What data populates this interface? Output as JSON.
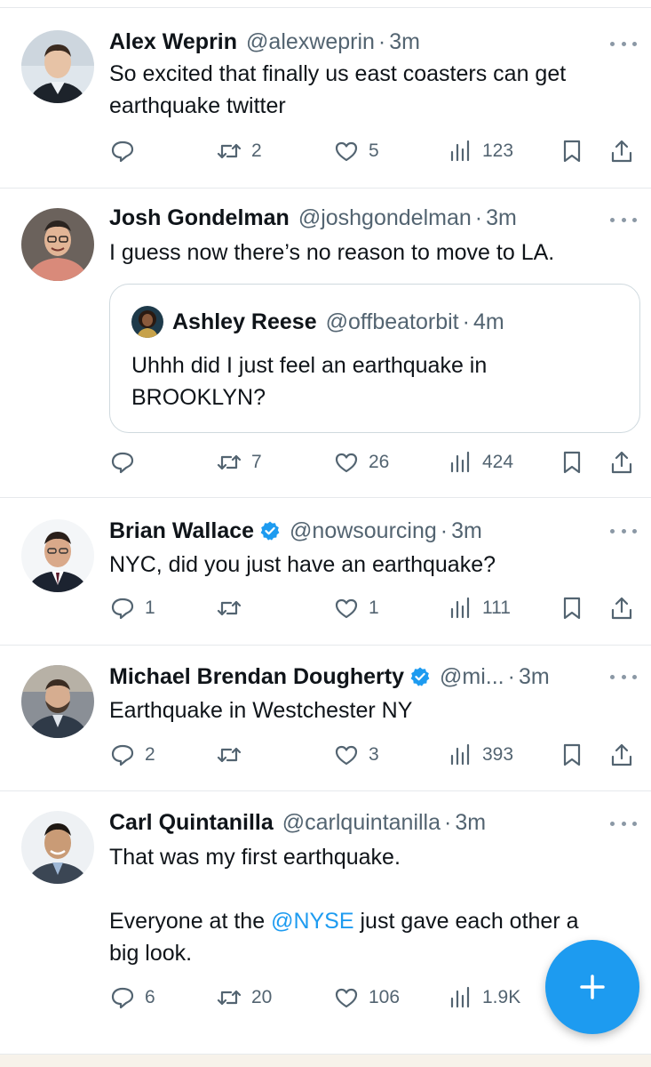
{
  "tweets": [
    {
      "name": "Alex Weprin",
      "handle": "@alexweprin",
      "time": "3m",
      "verified": false,
      "text_lines": [
        "So excited that finally us east coasters can get",
        "earthquake twitter"
      ],
      "replies": "",
      "retweets": "2",
      "likes": "5",
      "views": "123"
    },
    {
      "name": "Josh Gondelman",
      "handle": "@joshgondelman",
      "time": "3m",
      "verified": false,
      "text_lines": [
        "I guess now there’s no reason to move to LA."
      ],
      "quote": {
        "name": "Ashley Reese",
        "handle": "@offbeatorbit",
        "time": "4m",
        "text_lines": [
          "Uhhh did I just feel an earthquake in",
          "BROOKLYN?"
        ]
      },
      "replies": "",
      "retweets": "7",
      "likes": "26",
      "views": "424"
    },
    {
      "name": "Brian Wallace",
      "handle": "@nowsourcing",
      "time": "3m",
      "verified": true,
      "text_lines": [
        "NYC, did you just have an earthquake?"
      ],
      "replies": "1",
      "retweets": "",
      "likes": "1",
      "views": "111"
    },
    {
      "name": "Michael Brendan Dougherty",
      "handle": "@mi...",
      "time": "3m",
      "verified": true,
      "text_lines": [
        "Earthquake in Westchester NY"
      ],
      "replies": "2",
      "retweets": "",
      "likes": "3",
      "views": "393"
    },
    {
      "name": "Carl Quintanilla",
      "handle": "@carlquintanilla",
      "time": "3m",
      "verified": false,
      "text_lines": [
        "That was my first earthquake.",
        "",
        "Everyone at the",
        "just gave each other a",
        "big look."
      ],
      "mention": "@NYSE",
      "replies": "6",
      "retweets": "20",
      "likes": "106",
      "views": "1.9K"
    }
  ],
  "separator": "·",
  "colors": {
    "accent": "#1d9bf0",
    "text": "#0f1419",
    "secondary": "#536471",
    "border": "#e6e9ec",
    "verified": "#1d9bf0"
  },
  "icons": {
    "reply": "reply-icon",
    "retweet": "retweet-icon",
    "like": "like-icon",
    "views": "views-icon",
    "bookmark": "bookmark-icon",
    "share": "share-icon",
    "more": "more-icon",
    "verified": "verified-badge-icon",
    "compose": "compose-plus-icon"
  }
}
